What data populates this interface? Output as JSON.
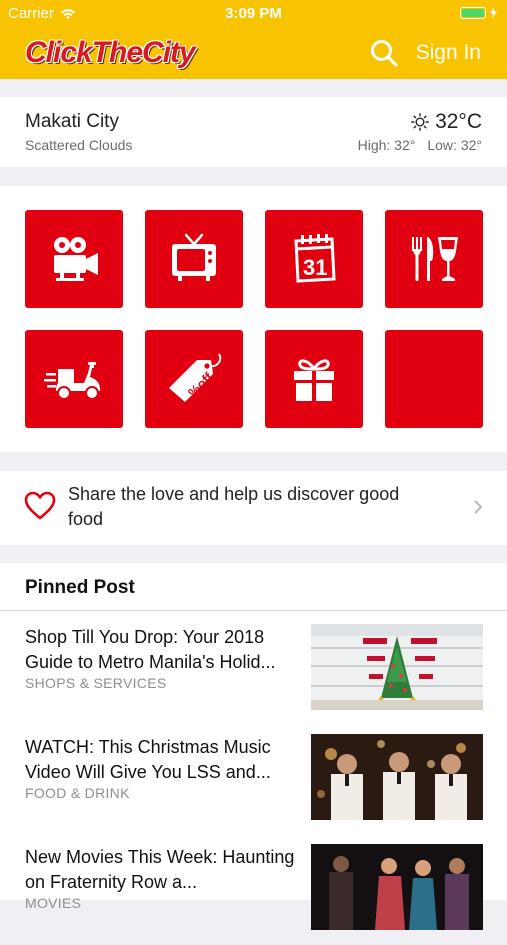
{
  "status_bar": {
    "carrier": "Carrier",
    "time": "3:09 PM"
  },
  "header": {
    "logo": "ClickTheCity",
    "sign_in": "Sign In",
    "brand_color": "#f8c300"
  },
  "weather": {
    "city": "Makati City",
    "condition": "Scattered Clouds",
    "temperature": "32°C",
    "high": "High: 32°",
    "low": "Low: 32°"
  },
  "categories": [
    {
      "icon": "movie-camera-icon"
    },
    {
      "icon": "tv-icon"
    },
    {
      "icon": "calendar-icon"
    },
    {
      "icon": "food-drink-icon"
    },
    {
      "icon": "delivery-scooter-icon"
    },
    {
      "icon": "sale-tag-icon"
    },
    {
      "icon": "gift-icon"
    },
    {
      "icon": ""
    }
  ],
  "share_love": {
    "text": "Share the love and help us discover good food"
  },
  "pinned": {
    "title": "Pinned Post",
    "posts": [
      {
        "title": "Shop Till You Drop: Your 2018 Guide to Metro Manila's Holid...",
        "category": "SHOPS & SERVICES"
      },
      {
        "title": "WATCH: This Christmas Music Video Will Give You LSS and...",
        "category": "FOOD & DRINK"
      },
      {
        "title": "New Movies This Week: Haunting on Fraternity Row a...",
        "category": "MOVIES"
      }
    ]
  },
  "colors": {
    "accent": "#e10010"
  }
}
